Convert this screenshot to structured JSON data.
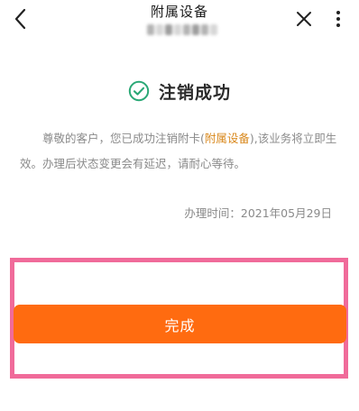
{
  "header": {
    "title": "附属设备",
    "back_icon": "chevron-left-icon",
    "close_icon": "close-icon",
    "more_icon": "more-vertical-icon"
  },
  "success": {
    "icon": "check-circle-icon",
    "title": "注销成功"
  },
  "description": {
    "before": "尊敬的客户，您已成功注销附卡(",
    "highlight": "附属设备",
    "after": "),该业务将立即生效。办理后状态变更会有延迟，请耐心等待。"
  },
  "handle_time": {
    "label": "办理时间：",
    "value": "2021年05月29日"
  },
  "done_button": {
    "label": "完成"
  },
  "colors": {
    "accent_green": "#2aa876",
    "button_orange": "#ff6b10",
    "highlight_orange": "#d9881c",
    "annotation_pink": "#f06b9a"
  }
}
